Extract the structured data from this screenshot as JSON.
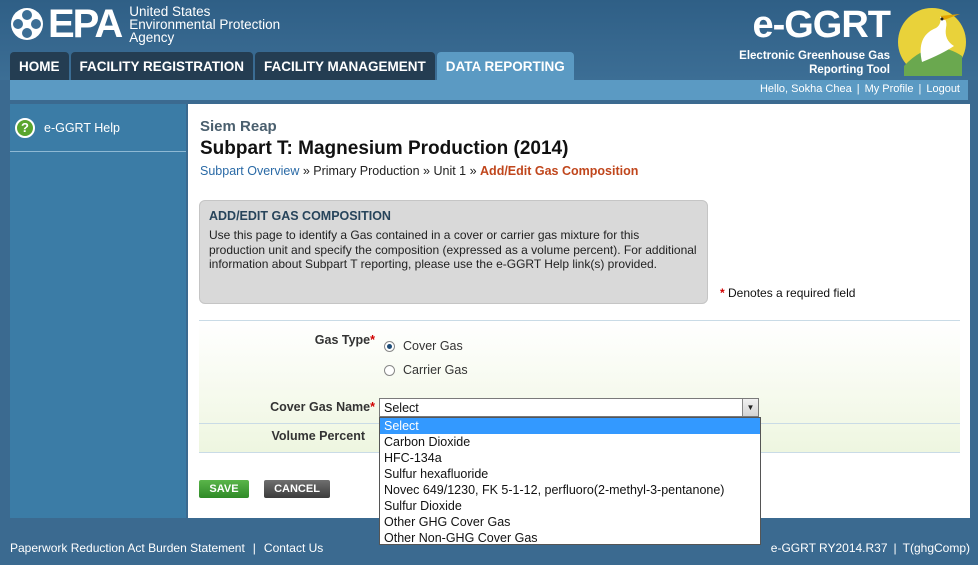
{
  "header": {
    "epa_word": "EPA",
    "agency_lines": [
      "United States",
      "Environmental Protection",
      "Agency"
    ],
    "brand_title": "e-GGRT",
    "brand_sub_lines": [
      "Electronic Greenhouse Gas",
      "Reporting Tool"
    ]
  },
  "nav": {
    "tabs": [
      {
        "label": "HOME",
        "active": false
      },
      {
        "label": "FACILITY REGISTRATION",
        "active": false
      },
      {
        "label": "FACILITY MANAGEMENT",
        "active": false
      },
      {
        "label": "DATA REPORTING",
        "active": true
      }
    ]
  },
  "userbar": {
    "greeting": "Hello, Sokha Chea",
    "profile": "My Profile",
    "logout": "Logout",
    "sep": "|"
  },
  "sidebar": {
    "help_icon": "?",
    "help_label": "e-GGRT Help"
  },
  "main": {
    "facility": "Siem Reap",
    "subpart": "Subpart T: Magnesium Production (2014)",
    "breadcrumb": {
      "overview": "Subpart Overview",
      "sep1": " » ",
      "primary": "Primary Production",
      "sep2": " » ",
      "unit": "Unit 1",
      "sep3": " » ",
      "current": "Add/Edit Gas Composition"
    },
    "infobox": {
      "title": "ADD/EDIT GAS COMPOSITION",
      "text": "Use this page to identify a Gas contained in a cover or carrier gas mixture for this production unit and specify the composition (expressed as a volume percent). For additional information about Subpart T reporting, please use the e-GGRT Help link(s) provided."
    },
    "required_star": "*",
    "required_note": "Denotes a required field"
  },
  "form": {
    "gas_type_label": "Gas Type",
    "cover_gas_option": "Cover Gas",
    "carrier_gas_option": "Carrier Gas",
    "cover_gas_name_label": "Cover Gas Name",
    "select_value": "Select",
    "select_arrow": "▼",
    "volume_percent_label": "Volume Percent",
    "save_label": "SAVE",
    "cancel_label": "CANCEL"
  },
  "dropdown": {
    "options": [
      "Select",
      "Carbon Dioxide",
      "HFC-134a",
      "Sulfur hexafluoride",
      "Novec 649/1230, FK 5-1-12, perfluoro(2-methyl-3-pentanone)",
      "Sulfur Dioxide",
      "Other GHG Cover Gas",
      "Other Non-GHG Cover Gas"
    ]
  },
  "footer": {
    "paperwork": "Paperwork Reduction Act Burden Statement",
    "contact": "Contact Us",
    "version": "e-GGRT RY2014.R37",
    "code": "T(ghgComp)",
    "sep": "|"
  },
  "colors": {
    "header_blue": "#3c6e95",
    "accent_light_blue": "#5b9ac3",
    "breadcrumb_current": "#c0461c",
    "save_green": "#2f8a27"
  }
}
